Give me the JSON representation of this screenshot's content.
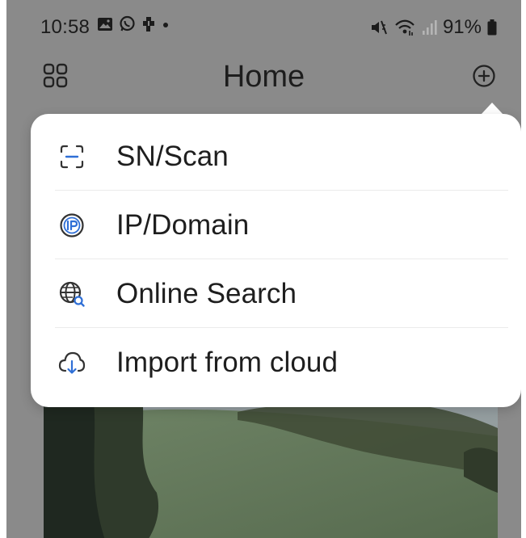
{
  "status_bar": {
    "time": "10:58",
    "battery": "91%",
    "left_icons": [
      "gallery-icon",
      "whatsapp-icon",
      "app-icon",
      "dot-icon"
    ],
    "right_icons": [
      "mute-icon",
      "wifi-icon",
      "signal-icon",
      "battery-icon"
    ]
  },
  "header": {
    "title": "Home",
    "left_icon": "grid-icon",
    "right_icon": "add-circle-icon"
  },
  "add_menu": {
    "items": [
      {
        "label": "SN/Scan",
        "icon": "scan-icon"
      },
      {
        "label": "IP/Domain",
        "icon": "ip-icon"
      },
      {
        "label": "Online Search",
        "icon": "globe-search-icon"
      },
      {
        "label": "Import from cloud",
        "icon": "cloud-download-icon"
      }
    ]
  },
  "colors": {
    "overlay": "#8a8a8a",
    "menu_background": "#ffffff",
    "text": "#1e1e1e",
    "icon": "#333333"
  }
}
